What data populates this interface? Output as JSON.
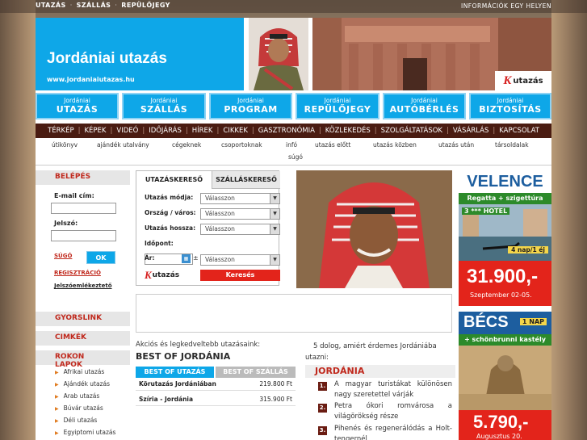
{
  "topnav": {
    "items": [
      "UTAZÁS",
      "SZÁLLÁS",
      "REPÜLŐJEGY"
    ],
    "right_text": "INFORMÁCIÓK EGY HELYEN"
  },
  "header": {
    "title": "Jordániai utazás",
    "url": "www.jordaniaiutazas.hu",
    "logo_k": "K",
    "logo_text": "utazás"
  },
  "services": [
    {
      "top": "Jordániai",
      "label": "UTAZÁS"
    },
    {
      "top": "Jordániai",
      "label": "SZÁLLÁS"
    },
    {
      "top": "Jordániai",
      "label": "PROGRAM"
    },
    {
      "top": "Jordániai",
      "label": "REPÜLŐJEGY"
    },
    {
      "top": "Jordániai",
      "label": "AUTÓBÉRLÉS"
    },
    {
      "top": "Jordániai",
      "label": "BIZTOSÍTÁS"
    }
  ],
  "mainnav": [
    "TÉRKÉP",
    "KÉPEK",
    "VIDEÓ",
    "IDŐJÁRÁS",
    "HÍREK",
    "CIKKEK",
    "GASZTRONÓMIA",
    "KÖZLEKEDÉS",
    "SZOLGÁLTATÁSOK",
    "VÁSÁRLÁS",
    "KAPCSOLAT"
  ],
  "subnav": [
    "útikönyv",
    "ajándék utalvány",
    "cégeknek",
    "csoportoknak",
    "infó",
    "utazás előtt",
    "utazás közben",
    "utazás után",
    "társoldalak",
    "súgó"
  ],
  "login": {
    "title": "BELÉPÉS",
    "email_label": "E-mail cím:",
    "password_label": "Jelszó:",
    "help": "SÚGÓ",
    "ok": "OK",
    "register": "REGISZTRÁCIÓ",
    "forgot": "Jelszóemlékeztető"
  },
  "side_sections": {
    "quicklink": "GYORSLINK",
    "tags": "CIMKÉK",
    "related": "ROKON LAPOK",
    "related_items": [
      "Afrikai utazás",
      "Ajándék utazás",
      "Arab utazás",
      "Búvár utazás",
      "Déli utazás",
      "Egyiptomi utazás"
    ]
  },
  "search": {
    "tab_active": "UTAZÁSKERESŐ",
    "tab_inactive": "SZÁLLÁSKERESŐ",
    "mode_label": "Utazás módja:",
    "country_label": "Ország / város:",
    "length_label": "Utazás hossza:",
    "time_label": "Időpont:",
    "price_label": "Ár:",
    "pm": "±",
    "select_placeholder": "Válasszon",
    "submit": "Keresés",
    "logo_k": "K",
    "logo_text": "utazás"
  },
  "bestof": {
    "intro": "Akciós és legkedveltebb utazásaink:",
    "title": "BEST OF JORDÁNIA",
    "tab1": "BEST OF UTAZÁS",
    "tab2": "BEST OF SZÁLLÁS",
    "rows": [
      {
        "name": "Körutazás Jordániában",
        "price": "219.800 Ft"
      },
      {
        "name": "Szíria - Jordánia",
        "price": "315.900 Ft"
      }
    ]
  },
  "five": {
    "intro": "5 dolog, amiért érdemes Jordániába utazni:",
    "title": "JORDÁNIA",
    "reasons": [
      "A magyar turistákat különösen nagy szeretettel várják",
      "Petra ókori romvárosa a világörökség része",
      "Pihenés és regenerálódás a Holt-tengernél"
    ]
  },
  "ads": {
    "ad1": {
      "city": "VELENCE",
      "sub": "Regatta + szigettúra",
      "hotel": "3 *** HOTEL",
      "nights": "4 nap/1 éj",
      "price": "31.900,-",
      "date": "Szeptember 02-05."
    },
    "ad2": {
      "city": "BÉCS",
      "days": "1 NAP",
      "sub": "+ schönbrunni kastély",
      "price": "5.790,-",
      "date": "Augusztus 20."
    }
  },
  "colors": {
    "accent_blue": "#0ea7e8",
    "nav_dark": "#4a1c12",
    "red": "#e3241b"
  }
}
